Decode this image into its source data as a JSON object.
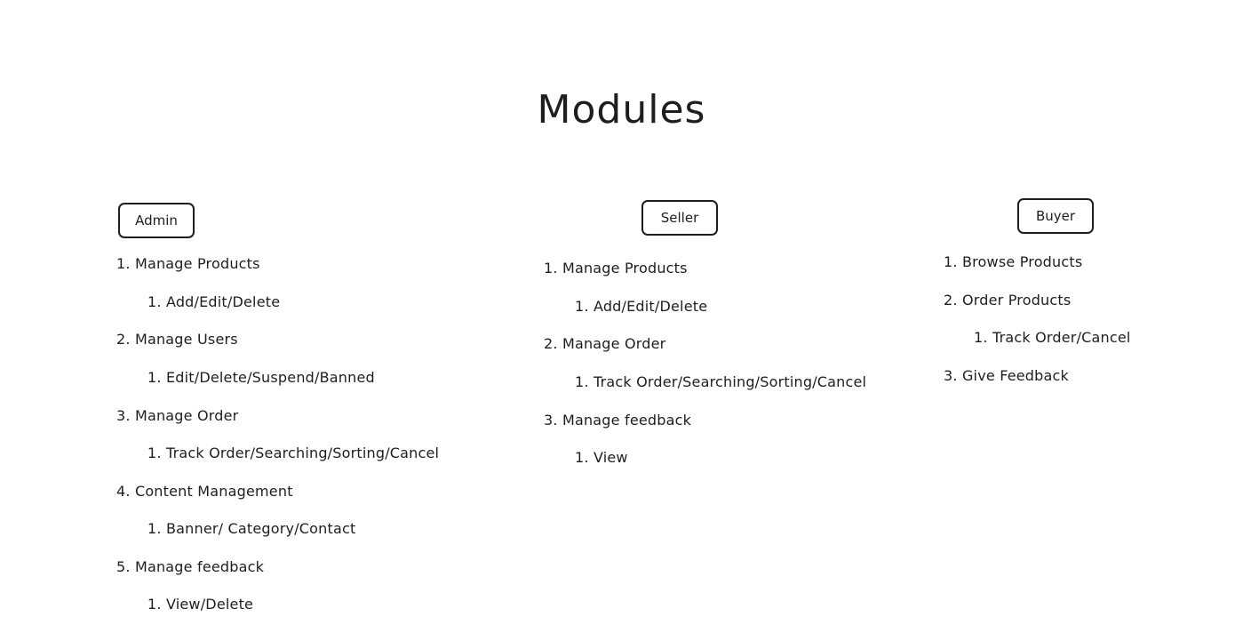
{
  "title": "Modules",
  "admin": {
    "label": "Admin",
    "items": [
      "1. Manage Products",
      "1. Add/Edit/Delete",
      "2. Manage Users",
      "1. Edit/Delete/Suspend/Banned",
      "3. Manage Order",
      "1. Track Order/Searching/Sorting/Cancel",
      "4. Content Management",
      "1. Banner/ Category/Contact",
      "5. Manage feedback",
      "1. View/Delete"
    ]
  },
  "seller": {
    "label": "Seller",
    "items": [
      "1. Manage Products",
      "1. Add/Edit/Delete",
      "2. Manage Order",
      "1. Track Order/Searching/Sorting/Cancel",
      "3. Manage feedback",
      "1. View"
    ]
  },
  "buyer": {
    "label": "Buyer",
    "items": [
      "1. Browse Products",
      "2. Order Products",
      "1. Track Order/Cancel",
      "3. Give Feedback"
    ]
  }
}
